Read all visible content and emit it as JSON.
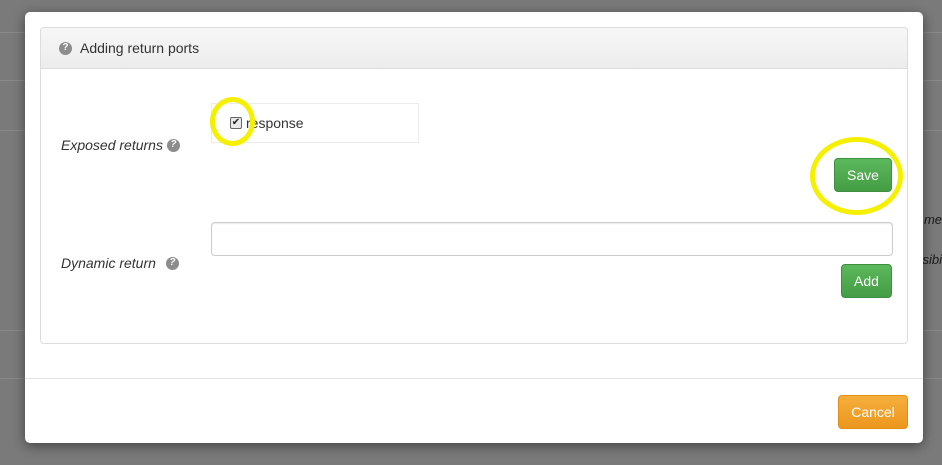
{
  "panel": {
    "title": "Adding return ports"
  },
  "exposed_returns": {
    "label": "Exposed returns",
    "items": [
      {
        "label": "response",
        "checked": true
      }
    ],
    "save_label": "Save"
  },
  "dynamic_return": {
    "label": "Dynamic return",
    "input_value": "",
    "add_label": "Add"
  },
  "footer": {
    "cancel_label": "Cancel"
  },
  "background": {
    "partial_text_1": "me",
    "partial_text_2": "sibi"
  },
  "icons": {
    "help": "question-circle-icon",
    "check": "check-icon"
  },
  "colors": {
    "success": "#5cb85c",
    "warning": "#f0ad4e",
    "highlight": "#f5f000"
  }
}
